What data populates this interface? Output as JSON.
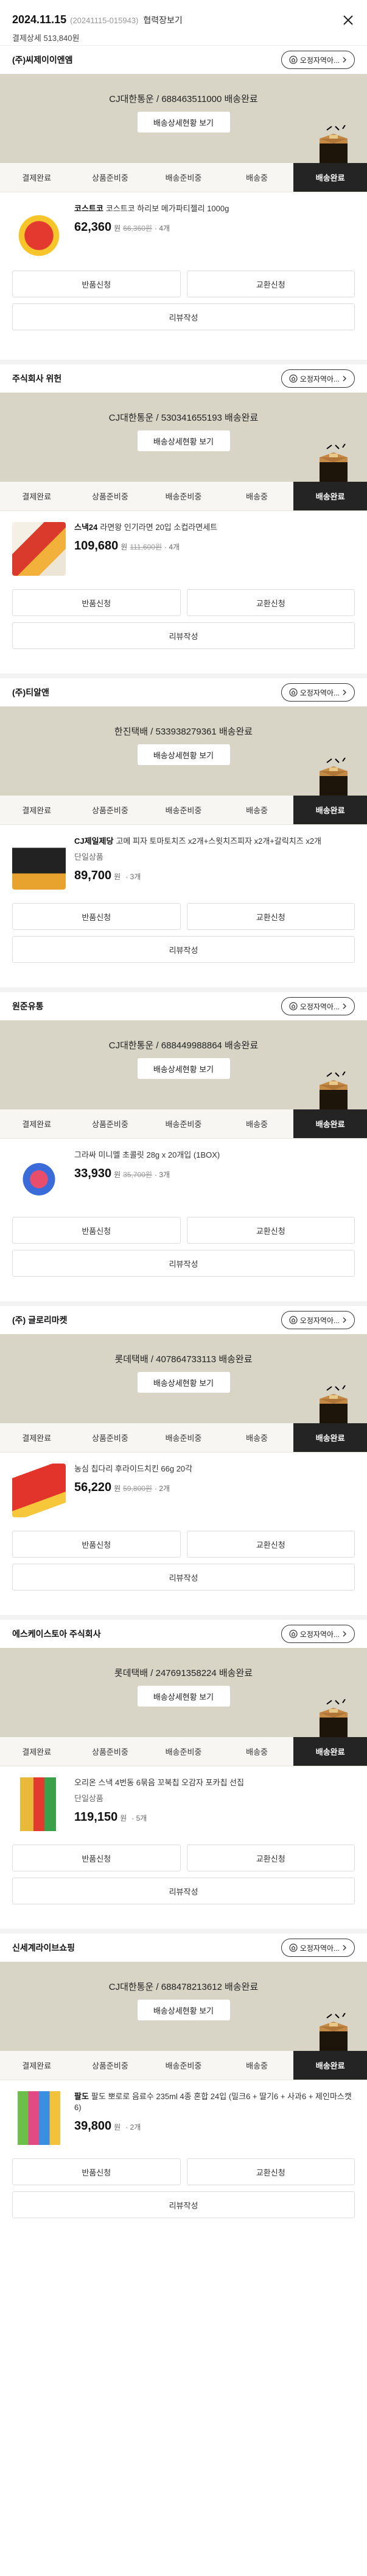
{
  "header": {
    "date": "2024.11.15",
    "order_no": "(20241115-015943)",
    "detail_link": "협력장보기",
    "payment": "결제상세 513,840원"
  },
  "steps": [
    "결제완료",
    "상품준비중",
    "배송준비중",
    "배송중",
    "배송완료"
  ],
  "buttons": {
    "return": "반품신청",
    "exchange": "교환신청",
    "review": "리뷰작성",
    "track": "배송상세현황 보기",
    "shop": "오정자역아..."
  },
  "sellers": [
    {
      "name": "(주)씨제이이엔엠",
      "carrier": "CJ대한통운 / 688463511000 배송완료",
      "brand": "코스트코",
      "product": "코스트코 하리보 메가파티젤리 1000g",
      "option": "",
      "price": "62,360",
      "orig": "66,360원",
      "qty": "4개"
    },
    {
      "name": "주식회사 위헌",
      "carrier": "CJ대한통운 / 530341655193 배송완료",
      "brand": "스낵24",
      "product": "라면왕 인기라면 20입 소컵라면세트",
      "option": "",
      "price": "109,680",
      "orig": "111,600원",
      "qty": "4개"
    },
    {
      "name": "(주)티알앤",
      "carrier": "한진택배 / 533938279361 배송완료",
      "brand": "CJ제일제당",
      "product": "고메 피자 토마토치즈 x2개+스윗치즈피자 x2개+갈릭치즈 x2개",
      "option": "단일상품",
      "price": "89,700",
      "orig": "",
      "qty": "3개"
    },
    {
      "name": "원준유통",
      "carrier": "CJ대한통운 / 688449988864 배송완료",
      "brand": "",
      "product": "그라싸 미니멜 초콜릿 28g x 20개입 (1BOX)",
      "option": "",
      "price": "33,930",
      "orig": "35,700원",
      "qty": "3개"
    },
    {
      "name": "(주) 글로리마켓",
      "carrier": "롯데택배 / 407864733113 배송완료",
      "brand": "",
      "product": "농심 칩다리 후라이드치킨 66g 20각",
      "option": "",
      "price": "56,220",
      "orig": "59,800원",
      "qty": "2개"
    },
    {
      "name": "에스케이스토아 주식회사",
      "carrier": "롯데택배 / 247691358224 배송완료",
      "brand": "",
      "product": "오리온 스낵 4번동 6묶음 꼬북칩 오감자 포카칩 선집",
      "option": "단일상품",
      "price": "119,150",
      "orig": "",
      "qty": "5개"
    },
    {
      "name": "신세계라이브쇼핑",
      "carrier": "CJ대한통운 / 688478213612 배송완료",
      "brand": "팔도",
      "product": "팔도 뽀로로 음료수 235ml 4종 혼합 24입 (밀크6 + 딸기6 + 사과6 + 제인마스캣6)",
      "option": "",
      "price": "39,800",
      "orig": "",
      "qty": "2개"
    }
  ],
  "colors": {
    "tracking_bg": "#d9d5c6",
    "active_step": "#242424"
  }
}
